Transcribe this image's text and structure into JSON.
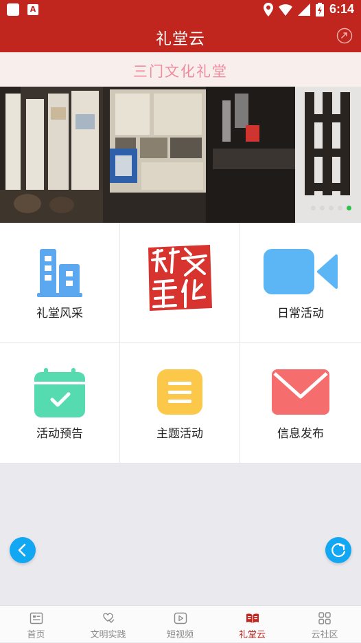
{
  "status_bar": {
    "time": "6:14",
    "notification_badge": "A"
  },
  "header": {
    "title": "礼堂云"
  },
  "subheader": {
    "title": "三门文化礼堂"
  },
  "banner": {
    "slide_count": 5,
    "active_slide": 5
  },
  "grid": [
    {
      "label": "礼堂风采",
      "icon": "building-icon",
      "color": "#5ba8f0"
    },
    {
      "label": "",
      "icon": "culture-hall-logo-icon",
      "logo_text": "礼文堂化",
      "color": "#d8342f"
    },
    {
      "label": "日常活动",
      "icon": "video-camera-icon",
      "color": "#5cb6f5"
    },
    {
      "label": "活动预告",
      "icon": "calendar-check-icon",
      "color": "#56dbb0"
    },
    {
      "label": "主题活动",
      "icon": "list-menu-icon",
      "color": "#fcc84a"
    },
    {
      "label": "信息发布",
      "icon": "mail-icon",
      "color": "#f56d6d"
    }
  ],
  "fabs": {
    "left_icon": "back-arrow-icon",
    "right_icon": "refresh-icon",
    "color": "#12a7f2"
  },
  "tabs": [
    {
      "label": "首页",
      "icon": "home-icon",
      "active": false
    },
    {
      "label": "文明实践",
      "icon": "volunteer-icon",
      "active": false
    },
    {
      "label": "短视频",
      "icon": "play-icon",
      "active": false
    },
    {
      "label": "礼堂云",
      "icon": "book-icon",
      "active": true
    },
    {
      "label": "云社区",
      "icon": "grid-icon",
      "active": false
    }
  ],
  "colors": {
    "brand": "#c0261e",
    "accent_pink": "#f08a9e",
    "active_dot": "#2bc24a"
  }
}
